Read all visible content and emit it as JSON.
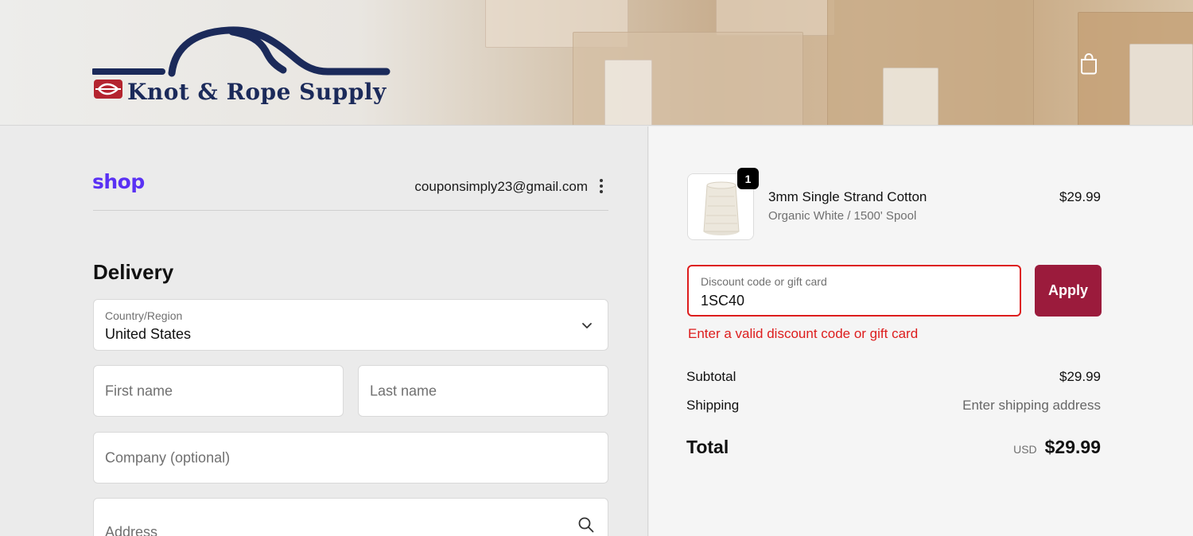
{
  "header": {
    "brand_name": "Knot & Rope Supply",
    "cart_icon": "shopping-bag-icon"
  },
  "account": {
    "shop_logo": "shop",
    "email": "couponsimply23@gmail.com",
    "menu_icon": "more-vertical-icon"
  },
  "delivery": {
    "title": "Delivery",
    "country": {
      "label": "Country/Region",
      "value": "United States",
      "icon": "chevron-down-icon"
    },
    "first_name": {
      "placeholder": "First name"
    },
    "last_name": {
      "placeholder": "Last name"
    },
    "company": {
      "placeholder": "Company (optional)"
    },
    "address": {
      "placeholder": "Address",
      "icon": "search-icon"
    }
  },
  "order": {
    "item": {
      "quantity": "1",
      "name": "3mm Single Strand Cotton",
      "variant": "Organic White / 1500' Spool",
      "price": "$29.99"
    },
    "discount": {
      "label": "Discount code or gift card",
      "value": "1SC40",
      "apply_label": "Apply",
      "error": "Enter a valid discount code or gift card"
    },
    "subtotal_label": "Subtotal",
    "subtotal_value": "$29.99",
    "shipping_label": "Shipping",
    "shipping_value": "Enter shipping address",
    "total_label": "Total",
    "total_currency": "USD",
    "total_value": "$29.99"
  },
  "colors": {
    "accent": "#9b1b3c",
    "error": "#dd1d1d",
    "shop_purple": "#5a31f4",
    "brand_navy": "#1b2a5a"
  }
}
